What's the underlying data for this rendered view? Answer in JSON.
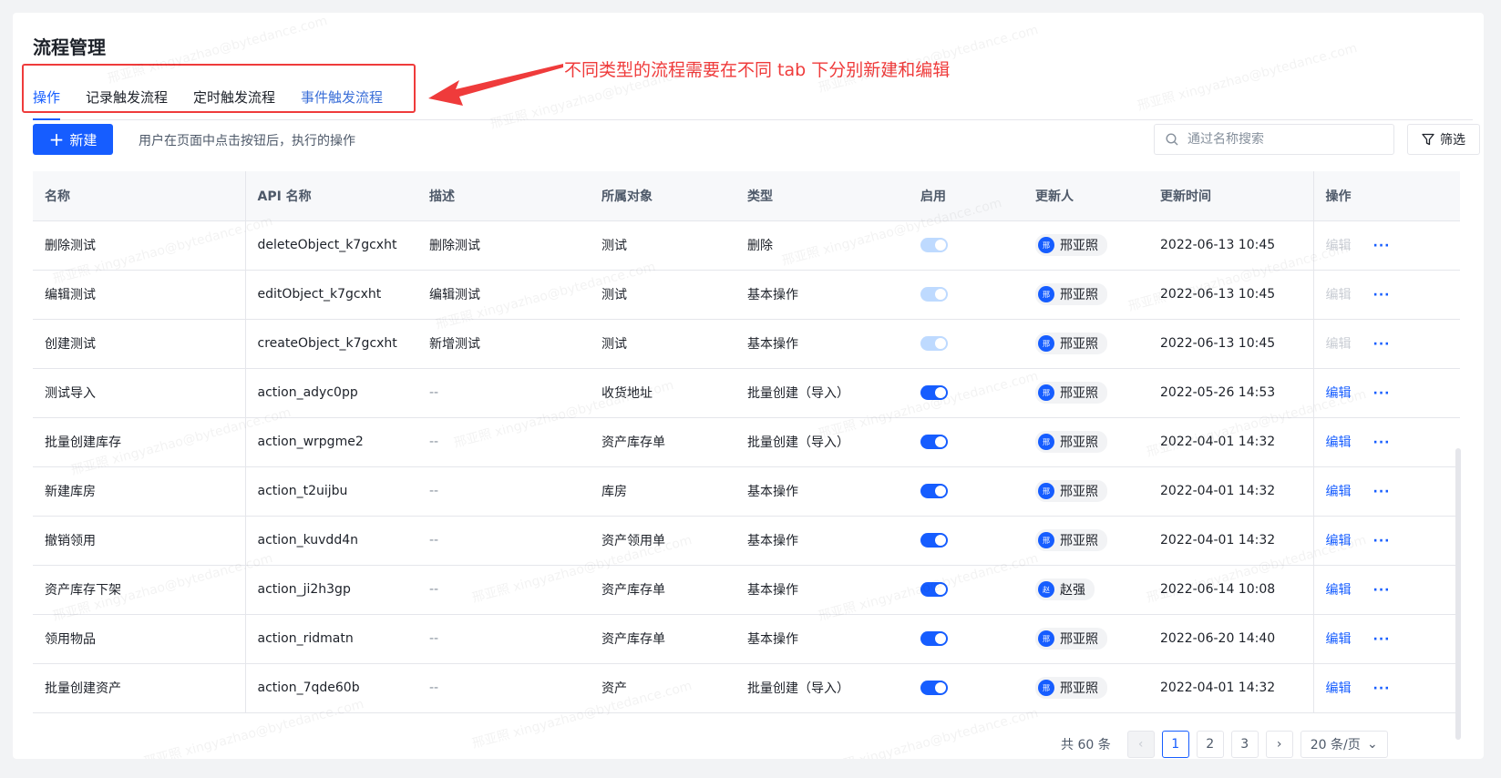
{
  "page": {
    "title": "流程管理"
  },
  "tabs": [
    {
      "label": "操作",
      "state": "active"
    },
    {
      "label": "记录触发流程",
      "state": "normal"
    },
    {
      "label": "定时触发流程",
      "state": "normal"
    },
    {
      "label": "事件触发流程",
      "state": "blue"
    }
  ],
  "annotation": {
    "text": "不同类型的流程需要在不同 tab 下分别新建和编辑",
    "color": "#ef3b3b"
  },
  "toolbar": {
    "new_label": "新建",
    "hint": "用户在页面中点击按钮后，执行的操作",
    "search_placeholder": "通过名称搜索",
    "filter_label": "筛选"
  },
  "table": {
    "columns": [
      "名称",
      "API 名称",
      "描述",
      "所属对象",
      "类型",
      "启用",
      "更新人",
      "更新时间",
      "操作"
    ],
    "edit_label": "编辑",
    "more_label": "···",
    "rows": [
      {
        "name": "删除测试",
        "api": "deleteObject_k7gcxht",
        "desc": "删除测试",
        "object": "测试",
        "type": "删除",
        "enabled": true,
        "switch_disabled": true,
        "user": "邢亚照",
        "avatar": "邢",
        "time": "2022-06-13 10:45",
        "edit_disabled": true
      },
      {
        "name": "编辑测试",
        "api": "editObject_k7gcxht",
        "desc": "编辑测试",
        "object": "测试",
        "type": "基本操作",
        "enabled": true,
        "switch_disabled": true,
        "user": "邢亚照",
        "avatar": "邢",
        "time": "2022-06-13 10:45",
        "edit_disabled": true
      },
      {
        "name": "创建测试",
        "api": "createObject_k7gcxht",
        "desc": "新增测试",
        "object": "测试",
        "type": "基本操作",
        "enabled": true,
        "switch_disabled": true,
        "user": "邢亚照",
        "avatar": "邢",
        "time": "2022-06-13 10:45",
        "edit_disabled": true
      },
      {
        "name": "测试导入",
        "api": "action_adyc0pp",
        "desc": "--",
        "object": "收货地址",
        "type": "批量创建（导入）",
        "enabled": true,
        "switch_disabled": false,
        "user": "邢亚照",
        "avatar": "邢",
        "time": "2022-05-26 14:53",
        "edit_disabled": false
      },
      {
        "name": "批量创建库存",
        "api": "action_wrpgme2",
        "desc": "--",
        "object": "资产库存单",
        "type": "批量创建（导入）",
        "enabled": true,
        "switch_disabled": false,
        "user": "邢亚照",
        "avatar": "邢",
        "time": "2022-04-01 14:32",
        "edit_disabled": false
      },
      {
        "name": "新建库房",
        "api": "action_t2uijbu",
        "desc": "--",
        "object": "库房",
        "type": "基本操作",
        "enabled": true,
        "switch_disabled": false,
        "user": "邢亚照",
        "avatar": "邢",
        "time": "2022-04-01 14:32",
        "edit_disabled": false
      },
      {
        "name": "撤销领用",
        "api": "action_kuvdd4n",
        "desc": "--",
        "object": "资产领用单",
        "type": "基本操作",
        "enabled": true,
        "switch_disabled": false,
        "user": "邢亚照",
        "avatar": "邢",
        "time": "2022-04-01 14:32",
        "edit_disabled": false
      },
      {
        "name": "资产库存下架",
        "api": "action_ji2h3gp",
        "desc": "--",
        "object": "资产库存单",
        "type": "基本操作",
        "enabled": true,
        "switch_disabled": false,
        "user": "赵强",
        "avatar": "赵",
        "time": "2022-06-14 10:08",
        "edit_disabled": false
      },
      {
        "name": "领用物品",
        "api": "action_ridmatn",
        "desc": "--",
        "object": "资产库存单",
        "type": "基本操作",
        "enabled": true,
        "switch_disabled": false,
        "user": "邢亚照",
        "avatar": "邢",
        "time": "2022-06-20 14:40",
        "edit_disabled": false
      },
      {
        "name": "批量创建资产",
        "api": "action_7qde60b",
        "desc": "--",
        "object": "资产",
        "type": "批量创建（导入）",
        "enabled": true,
        "switch_disabled": false,
        "user": "邢亚照",
        "avatar": "邢",
        "time": "2022-04-01 14:32",
        "edit_disabled": false
      }
    ]
  },
  "pagination": {
    "total": "共 60 条",
    "prev": "‹",
    "next": "›",
    "pages": [
      "1",
      "2",
      "3"
    ],
    "current": "1",
    "page_size": "20 条/页"
  },
  "watermark": {
    "text": "邢亚照 xingyazhao@bytedance.com"
  }
}
